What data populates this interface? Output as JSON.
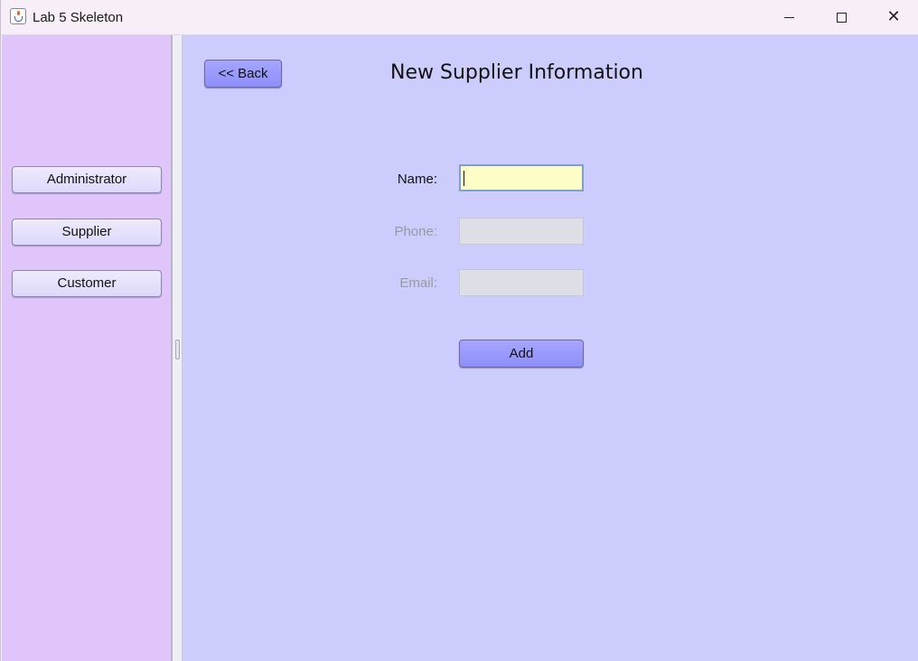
{
  "window": {
    "title": "Lab 5 Skeleton",
    "app_icon": "java-cup-icon",
    "controls": {
      "minimize": "minimize-icon",
      "maximize": "maximize-icon",
      "close": "close-icon"
    }
  },
  "sidebar": {
    "background": "#e0c5fa",
    "items": [
      {
        "label": "Administrator"
      },
      {
        "label": "Supplier"
      },
      {
        "label": "Customer"
      }
    ]
  },
  "main": {
    "background": "#ccccfd",
    "back_label": "<< Back",
    "title": "New Supplier Information",
    "form": {
      "name_label": "Name:",
      "name_value": "",
      "phone_label": "Phone:",
      "phone_value": "",
      "email_label": "Email:",
      "email_value": "",
      "add_label": "Add"
    }
  },
  "colors": {
    "accent_button": "#9a9afd",
    "focused_field": "#fdfdc8",
    "disabled_field": "#dedfe6",
    "disabled_text": "#9a9a9e"
  }
}
